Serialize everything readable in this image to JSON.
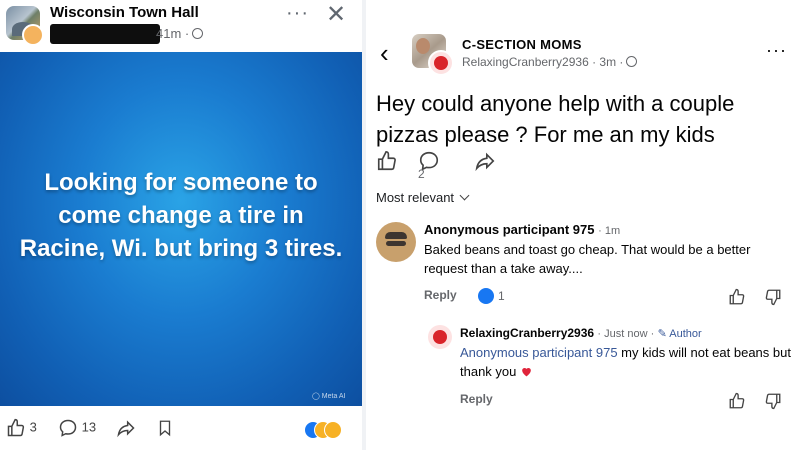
{
  "left_post": {
    "group_name": "Wisconsin Town Hall",
    "time": "41m ·",
    "more": "···",
    "close": "✕",
    "image_text": "Looking for someone to come change a tire in Racine, Wi. but bring 3 tires.",
    "image_watermark": "◯ Meta AI",
    "like_count": "3",
    "comment_count": "13"
  },
  "right_post": {
    "back": "‹",
    "group_name": "C-SECTION MOMS",
    "subtitle": "RelaxingCranberry2936 · 3m ·",
    "more": "···",
    "text": "Hey could anyone help with a couple pizzas please ? For me an my kids",
    "comment_count": "2",
    "sort_label": "Most relevant",
    "comments": [
      {
        "author": "Anonymous participant 975",
        "time": "· 1m",
        "text": "Baked beans and toast go cheap. That would be a better request than a take away....",
        "reply_label": "Reply",
        "reaction_count": "1"
      },
      {
        "author": "RelaxingCranberry2936",
        "time": "· Just now ·",
        "badge": "Author",
        "mention": "Anonymous participant 975",
        "text": " my kids will not eat beans but thank you",
        "reply_label": "Reply"
      }
    ]
  },
  "colors": {
    "facebook_blue": "#1877f2",
    "poster_blue": "#1a7cd0",
    "link_blue": "#385898",
    "secondary_text": "#65676b",
    "heart_red": "#e0243b"
  }
}
